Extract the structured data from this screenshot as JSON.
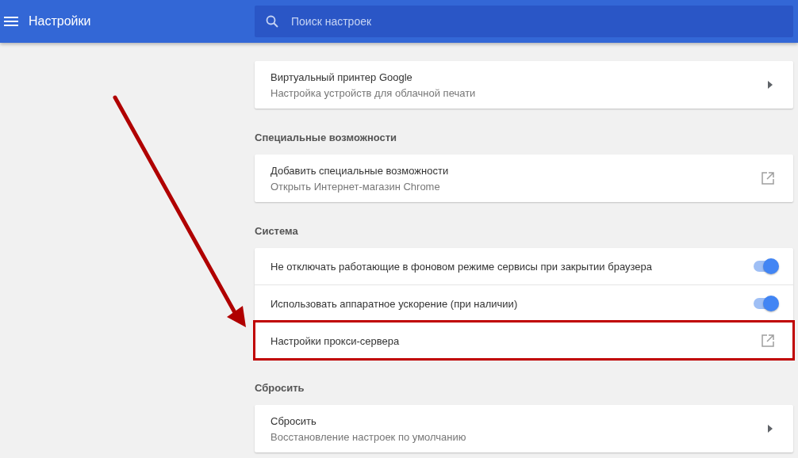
{
  "header": {
    "title": "Настройки",
    "search": {
      "placeholder": "Поиск настроек"
    }
  },
  "sections": [
    {
      "items": [
        {
          "kind": "submenu",
          "title": "Виртуальный принтер Google",
          "subtitle": "Настройка устройств для облачной печати",
          "highlighted": false
        }
      ]
    },
    {
      "title": "Специальные возможности",
      "items": [
        {
          "kind": "external",
          "title": "Добавить специальные возможности",
          "subtitle": "Открыть Интернет-магазин Chrome",
          "highlighted": false
        }
      ]
    },
    {
      "title": "Система",
      "items": [
        {
          "kind": "toggle",
          "title": "Не отключать работающие в фоновом режиме сервисы при закрытии браузера",
          "on": true,
          "highlighted": false
        },
        {
          "kind": "toggle",
          "title": "Использовать аппаратное ускорение (при наличии)",
          "on": true,
          "highlighted": false
        },
        {
          "kind": "external",
          "title": "Настройки прокси-сервера",
          "highlighted": true
        }
      ]
    },
    {
      "title": "Сбросить",
      "items": [
        {
          "kind": "submenu",
          "title": "Сбросить",
          "subtitle": "Восстановление настроек по умолчанию",
          "highlighted": false
        }
      ]
    }
  ]
}
